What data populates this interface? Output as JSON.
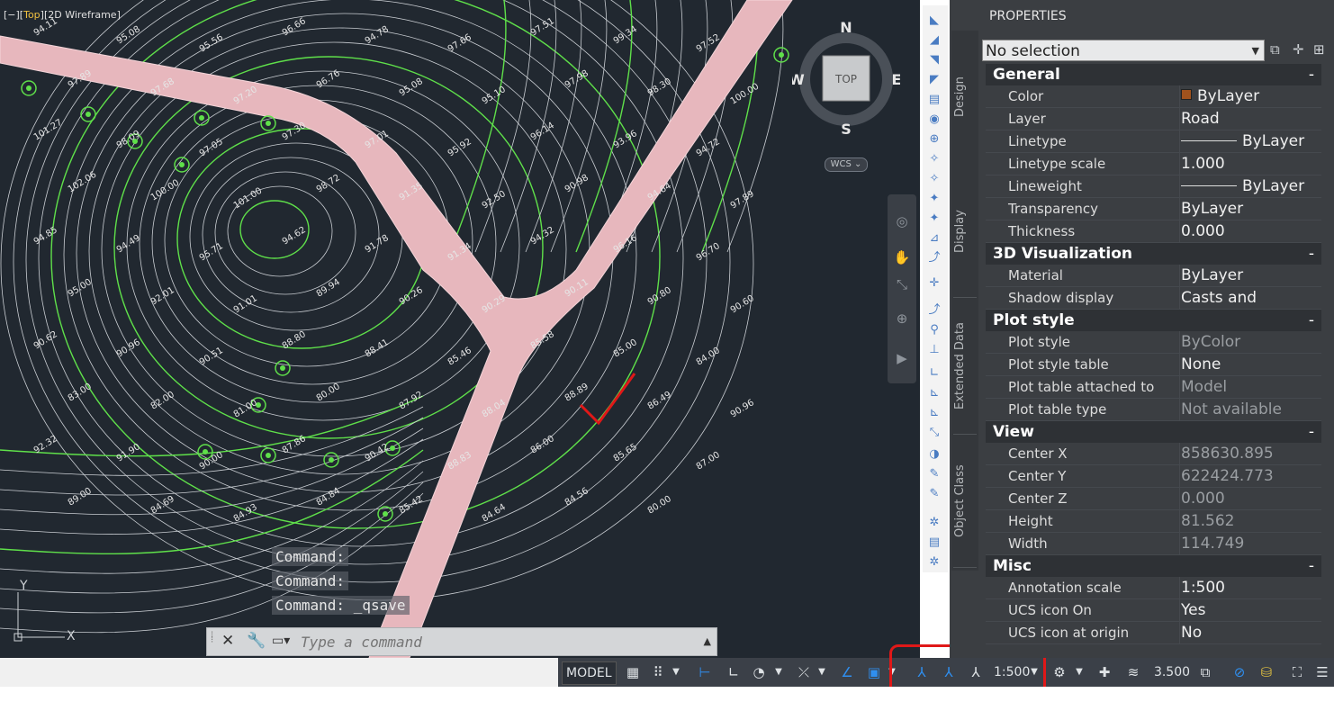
{
  "viewport": {
    "label_prefix": "[−][",
    "label_view": "Top",
    "label_mid": "][",
    "label_style": "2D Wireframe",
    "label_suffix": "]",
    "viewcube": {
      "top": "TOP",
      "n": "N",
      "s": "S",
      "e": "E",
      "w": "W"
    },
    "wcs": "WCS",
    "ucs": {
      "x": "X",
      "y": "Y"
    },
    "contour_labels": [
      "94.11",
      "95.08",
      "95.56",
      "96.66",
      "94.78",
      "97.66",
      "97.51",
      "99.34",
      "97.52",
      "97.89",
      "97.68",
      "97.20",
      "96.76",
      "95.08",
      "95.10",
      "97.98",
      "98.30",
      "100.00",
      "101.27",
      "98.09",
      "97.05",
      "97.30",
      "97.01",
      "95.92",
      "96.14",
      "93.96",
      "94.72",
      "102.06",
      "100.00",
      "101.00",
      "98.72",
      "91.35",
      "92.50",
      "90.98",
      "94.64",
      "97.89",
      "94.85",
      "94.49",
      "95.71",
      "94.62",
      "91.78",
      "91.34",
      "94.32",
      "96.16",
      "96.70",
      "95.00",
      "92.01",
      "91.01",
      "89.94",
      "90.26",
      "90.29",
      "90.11",
      "90.80",
      "90.60",
      "90.62",
      "90.96",
      "90.51",
      "88.80",
      "88.41",
      "85.46",
      "85.58",
      "85.00",
      "84.00",
      "83.00",
      "82.00",
      "81.00",
      "80.00",
      "87.92",
      "88.04",
      "88.89",
      "86.49",
      "90.96",
      "92.32",
      "91.90",
      "90.00",
      "87.86",
      "90.42",
      "88.83",
      "86.00",
      "85.65",
      "87.00",
      "89.00",
      "84.69",
      "84.93",
      "84.84",
      "85.42",
      "84.64",
      "84.56",
      "80.00"
    ]
  },
  "command_history": [
    "Command:",
    "Command:",
    "Command:  _qsave"
  ],
  "command_input": {
    "placeholder": "Type a command"
  },
  "statusbar": {
    "model": "MODEL",
    "annotation_scale": "1:500",
    "lineweight_value": "3.500"
  },
  "palette": {
    "title": "PROPERTIES",
    "selector": "No selection",
    "tabs": [
      "Design",
      "Display",
      "Extended Data",
      "Object Class"
    ],
    "sections": [
      {
        "title": "General",
        "rows": [
          {
            "k": "Color",
            "v": "ByLayer"
          },
          {
            "k": "Layer",
            "v": "Road"
          },
          {
            "k": "Linetype",
            "v": "ByLayer"
          },
          {
            "k": "Linetype scale",
            "v": "1.000"
          },
          {
            "k": "Lineweight",
            "v": "ByLayer"
          },
          {
            "k": "Transparency",
            "v": "ByLayer"
          },
          {
            "k": "Thickness",
            "v": "0.000"
          }
        ]
      },
      {
        "title": "3D Visualization",
        "rows": [
          {
            "k": "Material",
            "v": "ByLayer"
          },
          {
            "k": "Shadow display",
            "v": "Casts  and  Receiv..."
          }
        ]
      },
      {
        "title": "Plot style",
        "rows": [
          {
            "k": "Plot style",
            "v": "ByColor"
          },
          {
            "k": "Plot style table",
            "v": "None"
          },
          {
            "k": "Plot table attached to",
            "v": "Model"
          },
          {
            "k": "Plot table type",
            "v": "Not available"
          }
        ]
      },
      {
        "title": "View",
        "rows": [
          {
            "k": "Center X",
            "v": "858630.895"
          },
          {
            "k": "Center Y",
            "v": "622424.773"
          },
          {
            "k": "Center Z",
            "v": "0.000"
          },
          {
            "k": "Height",
            "v": "81.562"
          },
          {
            "k": "Width",
            "v": "114.749"
          }
        ]
      },
      {
        "title": "Misc",
        "rows": [
          {
            "k": "Annotation scale",
            "v": "1:500"
          },
          {
            "k": "UCS icon On",
            "v": "Yes"
          },
          {
            "k": "UCS icon at origin",
            "v": "No"
          }
        ]
      }
    ],
    "collapse_symbol": "-"
  },
  "colors": {
    "viewport_bg": "#212830",
    "road": "#e7b7bd",
    "index_contour": "#5fe04a",
    "contour": "#c9cdd2",
    "annotation": "#e01818"
  }
}
